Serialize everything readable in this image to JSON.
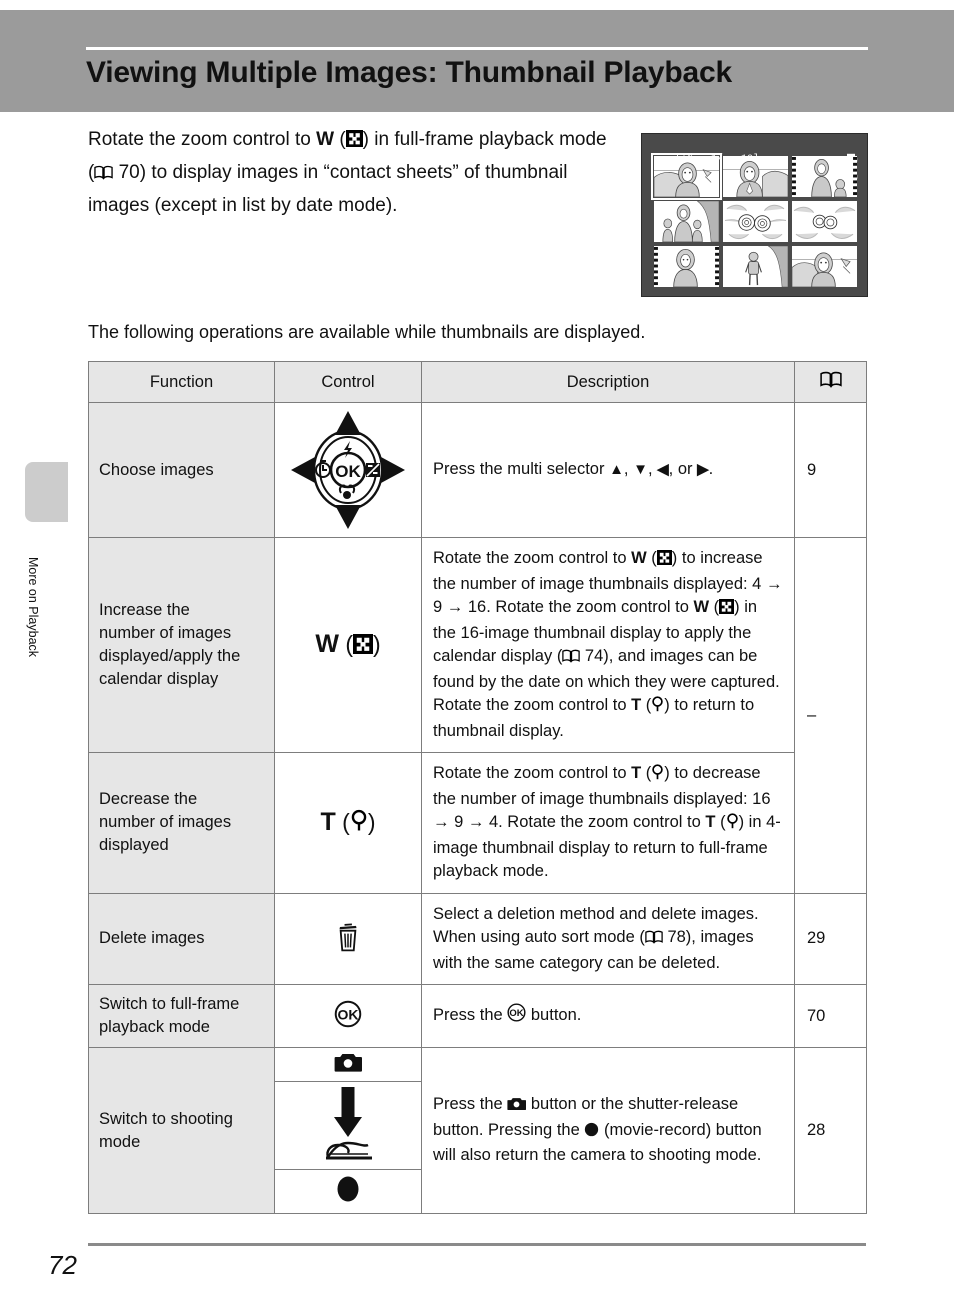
{
  "header": {
    "title": "Viewing Multiple Images: Thumbnail Playback"
  },
  "sidebar": {
    "tab_label": "More on Playback"
  },
  "intro": {
    "line1_a": "Rotate the zoom control to ",
    "line1_w": "W",
    "line1_b": " (",
    "line1_c": ") in full-frame",
    "line2_a": "playback mode (",
    "line2_page": " 70) to display images in “contact",
    "line3": "sheets” of thumbnail images (except in list by date",
    "line4": "mode)."
  },
  "lcd": {
    "status_left": "[ᴵᴺ   1/   10]",
    "status_icons": "print-order-icon protect-icon",
    "selected_index": 0,
    "thumbs": [
      {
        "kind": "portrait-landscape",
        "selected": true
      },
      {
        "kind": "portrait-landscape",
        "selected": false
      },
      {
        "kind": "movie-person-child",
        "selected": false
      },
      {
        "kind": "family-group",
        "selected": false
      },
      {
        "kind": "flowers-wide",
        "selected": false
      },
      {
        "kind": "flowers-small",
        "selected": false
      },
      {
        "kind": "movie-portrait",
        "selected": false
      },
      {
        "kind": "person-standing-tree",
        "selected": false
      },
      {
        "kind": "portrait-landscape",
        "selected": false
      }
    ]
  },
  "lead_sentence": "The following operations are available while thumbnails are displayed.",
  "table": {
    "headers": {
      "function": "Function",
      "control": "Control",
      "description": "Description",
      "reference": "book-icon"
    },
    "rows": [
      {
        "function": "Choose images",
        "control_icon": "multi-selector-icon",
        "control_text": "",
        "description_a": "Press the multi selector ",
        "description_up": "▲",
        "description_b": ", ",
        "description_down": "▼",
        "description_c": ", ",
        "description_left": "◀",
        "description_d": ", or ",
        "description_right": "▶",
        "description_e": ".",
        "reference": "9"
      },
      {
        "function_l1": "Increase the",
        "function_l2": "number of images",
        "function_l3": "displayed/apply the",
        "function_l4": "calendar display",
        "control_letter": "W",
        "control_icon": "thumbnail-checkerboard-icon",
        "desc_1": "Rotate the zoom control to ",
        "desc_w1": "W",
        "desc_2": ") to increase the number of image thumbnails displayed: 4 ",
        "desc_arrow1": "→",
        "desc_3": " 9 ",
        "desc_arrow2": "→",
        "desc_4": " 16. Rotate the zoom control to ",
        "desc_w2": "W",
        "desc_5": ") in the 16-image thumbnail display to apply the calendar display (",
        "desc_6": " 74), and images can be found by the date on which they were captured. Rotate the zoom control to ",
        "desc_t": "T",
        "desc_7": ") to return to thumbnail display.",
        "reference": "–"
      },
      {
        "function_l1": "Decrease the",
        "function_l2": "number of images",
        "function_l3": "displayed",
        "control_letter": "T",
        "control_icon": "magnifier-icon",
        "desc_1": "Rotate the zoom control to ",
        "desc_t1": "T",
        "desc_2": ") to decrease the number of image thumbnails displayed: 16 ",
        "desc_arrow1": "→",
        "desc_3": " 9 ",
        "desc_arrow2": "→",
        "desc_4": " 4. Rotate the zoom control to ",
        "desc_t2": "T",
        "desc_5": ") in 4-image thumbnail display to return to full-frame playback mode.",
        "reference": ""
      },
      {
        "function": "Delete images",
        "control_icon": "trash-icon",
        "desc_1": "Select a deletion method and delete images. When using auto sort mode (",
        "desc_2": " 78), images with the same category can be deleted.",
        "reference": "29"
      },
      {
        "function_l1": "Switch to full-frame",
        "function_l2": "playback mode",
        "control_icon": "ok-button-icon",
        "desc_1": "Press the ",
        "desc_2": " button.",
        "reference": "70"
      },
      {
        "function_l1": "Switch to shooting",
        "function_l2": "mode",
        "control_icon_1": "camera-mode-icon",
        "control_icon_2": "shutter-release-press-icon",
        "control_icon_3": "movie-record-button-icon",
        "desc_1": "Press the ",
        "desc_2": " button or the shutter-release button. Pressing the ",
        "desc_3": " (movie-record) button will also return the camera to shooting mode.",
        "reference": "28"
      }
    ]
  },
  "footer": {
    "page_number": "72"
  },
  "colors": {
    "header_band": "#9b9b9b",
    "table_header_bg": "#e6e6e6",
    "function_col_bg": "#e6e6e6",
    "table_border": "#7d7d7d",
    "lcd_bg": "#4a4a4a",
    "side_tab": "#cccccc"
  }
}
